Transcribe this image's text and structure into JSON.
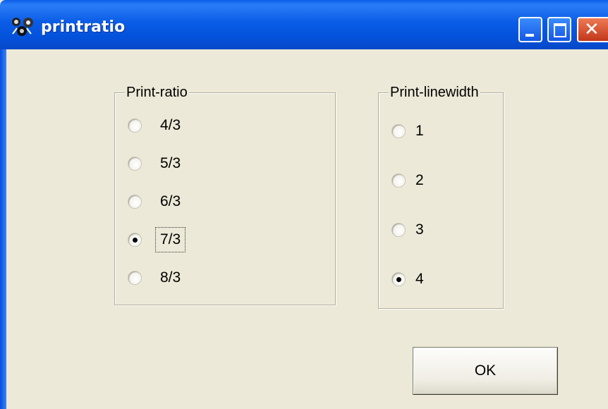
{
  "window": {
    "title": "printratio"
  },
  "print_ratio": {
    "label": "Print-ratio",
    "options": [
      "4/3",
      "5/3",
      "6/3",
      "7/3",
      "8/3"
    ],
    "selected": "7/3"
  },
  "print_linewidth": {
    "label": "Print-linewidth",
    "options": [
      "1",
      "2",
      "3",
      "4"
    ],
    "selected": "4"
  },
  "buttons": {
    "ok": "OK"
  },
  "colors": {
    "titlebar": "#0a5ce6",
    "dialog_bg": "#ece9d8",
    "close_button": "#d9532f"
  }
}
